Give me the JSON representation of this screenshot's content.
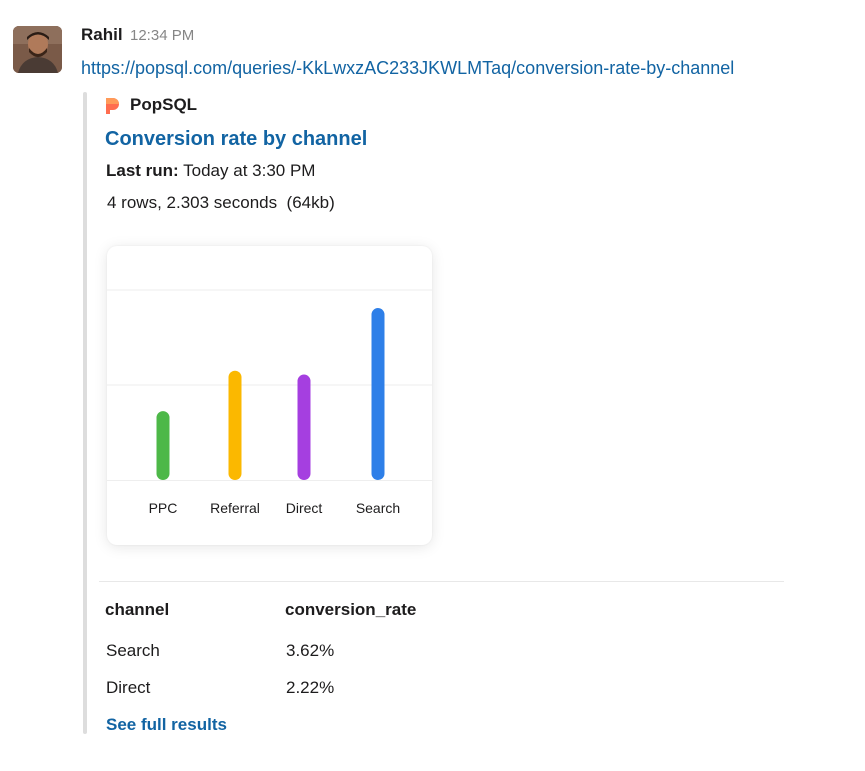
{
  "message": {
    "sender": "Rahil",
    "timestamp": "12:34 PM",
    "url": "https://popsql.com/queries/-KkLwxzAC233JKWLMTaq/conversion-rate-by-channel"
  },
  "attachment": {
    "app_name": "PopSQL",
    "app_icon": "popsql-logo-icon",
    "title": "Conversion rate by channel",
    "last_run_label": "Last run:",
    "last_run_value": " Today at 3:30 PM",
    "summary": "4 rows, 2.303 seconds  (64kb)",
    "table": {
      "headers": [
        "channel",
        "conversion_rate"
      ],
      "rows": [
        [
          "Search",
          "3.62%"
        ],
        [
          "Direct",
          "2.22%"
        ]
      ]
    },
    "see_full_results": "See full results"
  },
  "colors": {
    "link": "#1264a3",
    "ppc": "#4db848",
    "referral": "#fbb800",
    "direct": "#a53fe0",
    "search": "#2e7fe8"
  },
  "chart_data": {
    "type": "bar",
    "categories": [
      "PPC",
      "Referral",
      "Direct",
      "Search"
    ],
    "values": [
      1.45,
      2.3,
      2.22,
      3.62
    ],
    "colors": [
      "#4db848",
      "#fbb800",
      "#a53fe0",
      "#2e7fe8"
    ],
    "ylim": [
      0,
      4
    ],
    "grid": true,
    "title": "",
    "xlabel": "",
    "ylabel": ""
  }
}
